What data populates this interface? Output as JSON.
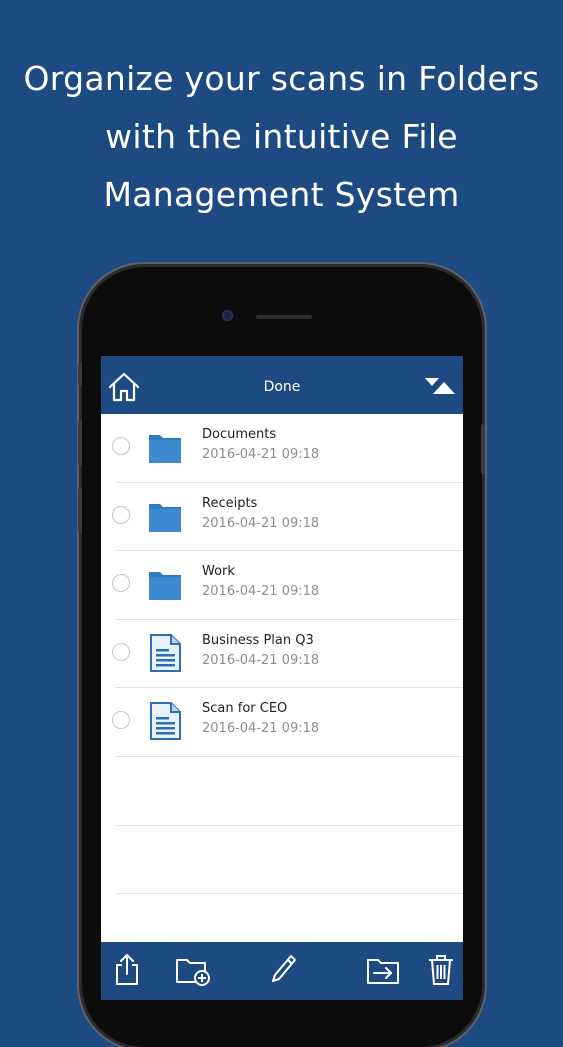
{
  "headline": {
    "line1": "Organize your scans in Folders",
    "line2": "with the intuitive File",
    "line3": "Management System"
  },
  "colors": {
    "background": "#1d4a80",
    "bar": "#1d4a80",
    "folder": "#2f7cc0",
    "document": "#2c6fb4"
  },
  "navbar": {
    "title": "Done",
    "left_icon": "home-icon",
    "right_icon": "sort-icon"
  },
  "items": [
    {
      "name": "Documents",
      "date": "2016-04-21 09:18",
      "type": "folder",
      "selected": false
    },
    {
      "name": "Receipts",
      "date": "2016-04-21 09:18",
      "type": "folder",
      "selected": false
    },
    {
      "name": "Work",
      "date": "2016-04-21 09:18",
      "type": "folder",
      "selected": false
    },
    {
      "name": "Business Plan Q3",
      "date": "2016-04-21 09:18",
      "type": "document",
      "selected": false
    },
    {
      "name": "Scan for CEO",
      "date": "2016-04-21 09:18",
      "type": "document",
      "selected": false
    }
  ],
  "toolbar": {
    "buttons": [
      "share-icon",
      "new-folder-icon",
      "edit-pencil-icon",
      "move-to-folder-icon",
      "trash-icon"
    ]
  }
}
